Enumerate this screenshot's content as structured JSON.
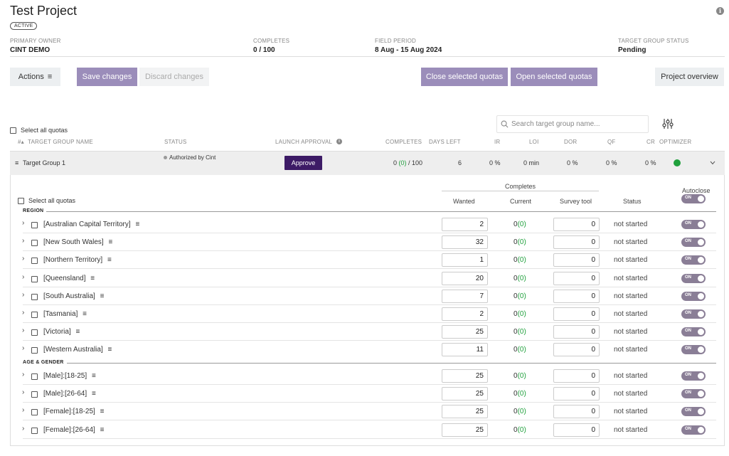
{
  "project": {
    "title": "Test Project",
    "status_badge": "ACTIVE"
  },
  "meta": {
    "primary_owner_label": "PRIMARY OWNER",
    "primary_owner_value": "CINT DEMO",
    "completes_label": "COMPLETES",
    "completes_value": "0 / 100",
    "field_period_label": "FIELD PERIOD",
    "field_period_value": "8 Aug - 15 Aug 2024",
    "target_group_status_label": "TARGET GROUP STATUS",
    "target_group_status_value": "Pending"
  },
  "toolbar": {
    "actions_label": "Actions",
    "save_label": "Save changes",
    "discard_label": "Discard changes",
    "close_quotas_label": "Close selected quotas",
    "open_quotas_label": "Open selected quotas",
    "project_overview_label": "Project overview"
  },
  "target_groups": {
    "select_all_label": "Select all quotas",
    "search_placeholder": "Search target group name...",
    "columns": {
      "name": "TARGET GROUP NAME",
      "status": "STATUS",
      "launch_approval": "LAUNCH APPROVAL",
      "completes": "COMPLETES",
      "days_left": "DAYS LEFT",
      "ir": "IR",
      "loi": "LOI",
      "dor": "DOR",
      "qf": "QF",
      "cr": "CR",
      "optimizer": "OPTIMIZER"
    },
    "row": {
      "name": "Target Group 1",
      "status": "Authorized by Cint",
      "approve_label": "Approve",
      "completes_current": "0",
      "completes_paren": "(0)",
      "completes_total": "/ 100",
      "days_left": "6",
      "ir": "0 %",
      "loi": "0 min",
      "dor": "0 %",
      "qf": "0 %",
      "cr": "0 %"
    }
  },
  "quotas": {
    "select_all_label": "Select all quotas",
    "completes_header": "Completes",
    "wanted_header": "Wanted",
    "current_header": "Current",
    "survey_tool_header": "Survey tool",
    "status_header": "Status",
    "autoclose_header": "Autoclose",
    "toggle_label": "ON",
    "sections": [
      {
        "label": "REGION",
        "rows": [
          {
            "name": "[Australian Capital Territory]",
            "wanted": "2",
            "current": "0",
            "paren": "(0)",
            "survey": "0",
            "status": "not started"
          },
          {
            "name": "[New South Wales]",
            "wanted": "32",
            "current": "0",
            "paren": "(0)",
            "survey": "0",
            "status": "not started"
          },
          {
            "name": "[Northern Territory]",
            "wanted": "1",
            "current": "0",
            "paren": "(0)",
            "survey": "0",
            "status": "not started"
          },
          {
            "name": "[Queensland]",
            "wanted": "20",
            "current": "0",
            "paren": "(0)",
            "survey": "0",
            "status": "not started"
          },
          {
            "name": "[South Australia]",
            "wanted": "7",
            "current": "0",
            "paren": "(0)",
            "survey": "0",
            "status": "not started"
          },
          {
            "name": "[Tasmania]",
            "wanted": "2",
            "current": "0",
            "paren": "(0)",
            "survey": "0",
            "status": "not started"
          },
          {
            "name": "[Victoria]",
            "wanted": "25",
            "current": "0",
            "paren": "(0)",
            "survey": "0",
            "status": "not started"
          },
          {
            "name": "[Western Australia]",
            "wanted": "11",
            "current": "0",
            "paren": "(0)",
            "survey": "0",
            "status": "not started"
          }
        ]
      },
      {
        "label": "AGE & GENDER",
        "rows": [
          {
            "name": "[Male]:[18-25]",
            "wanted": "25",
            "current": "0",
            "paren": "(0)",
            "survey": "0",
            "status": "not started"
          },
          {
            "name": "[Male]:[26-64]",
            "wanted": "25",
            "current": "0",
            "paren": "(0)",
            "survey": "0",
            "status": "not started"
          },
          {
            "name": "[Female]:[18-25]",
            "wanted": "25",
            "current": "0",
            "paren": "(0)",
            "survey": "0",
            "status": "not started"
          },
          {
            "name": "[Female]:[26-64]",
            "wanted": "25",
            "current": "0",
            "paren": "(0)",
            "survey": "0",
            "status": "not started"
          }
        ]
      }
    ]
  },
  "colors": {
    "accent_purple": "#9b8dba",
    "approve_dark": "#3d1b66",
    "green": "#1fa03c"
  }
}
